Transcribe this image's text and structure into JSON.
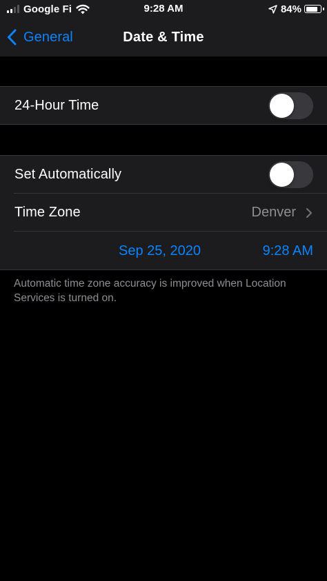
{
  "status_bar": {
    "carrier": "Google Fi",
    "time": "9:28 AM",
    "battery_percent": "84%",
    "battery_level": 0.84,
    "signal_bars_total": 4,
    "signal_bars_active": 2
  },
  "nav": {
    "back_label": "General",
    "title": "Date & Time"
  },
  "settings": {
    "twenty_four_hour": {
      "label": "24-Hour Time",
      "enabled": false
    },
    "set_automatically": {
      "label": "Set Automatically",
      "enabled": false
    },
    "time_zone": {
      "label": "Time Zone",
      "value": "Denver"
    },
    "date_time": {
      "date": "Sep 25, 2020",
      "time": "9:28 AM"
    }
  },
  "footer_note": "Automatic time zone accuracy is improved when Location Services is turned on.",
  "colors": {
    "accent": "#0a84ff",
    "background": "#000000",
    "cell_background": "#1c1c1e",
    "secondary_text": "#8e8e93",
    "toggle_off": "#39393d"
  },
  "icons": [
    "signal-icon",
    "wifi-icon",
    "location-arrow-icon",
    "battery-icon",
    "chevron-left-icon",
    "chevron-right-icon"
  ]
}
